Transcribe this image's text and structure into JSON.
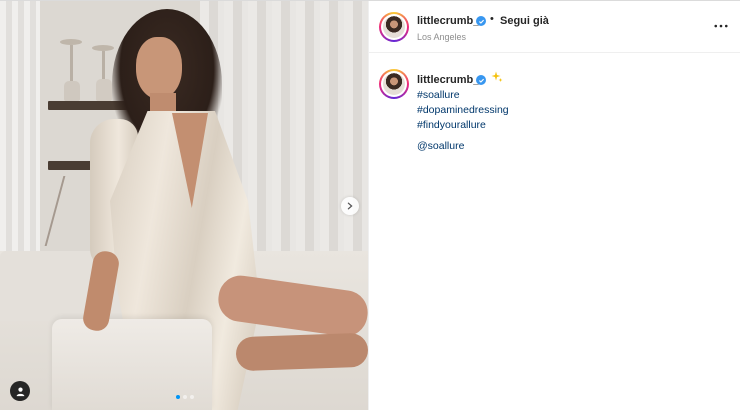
{
  "post": {
    "author": {
      "username": "littlecrumb_",
      "verified": true,
      "follow_label": "Segui già",
      "separator": "•",
      "location": "Los Angeles"
    },
    "caption": {
      "username": "littlecrumb_",
      "emoji_icon": "sparkles-icon",
      "hashtags": [
        "#soallure",
        "#dopaminedressing",
        "#findyourallure"
      ],
      "mention": "@soallure"
    },
    "carousel": {
      "slide_count": 3,
      "active_slide": 1
    }
  },
  "colors": {
    "link": "#00376b",
    "verified": "#3897f0",
    "active_dot": "#0095f6",
    "secondary_text": "#8e8e8e"
  }
}
